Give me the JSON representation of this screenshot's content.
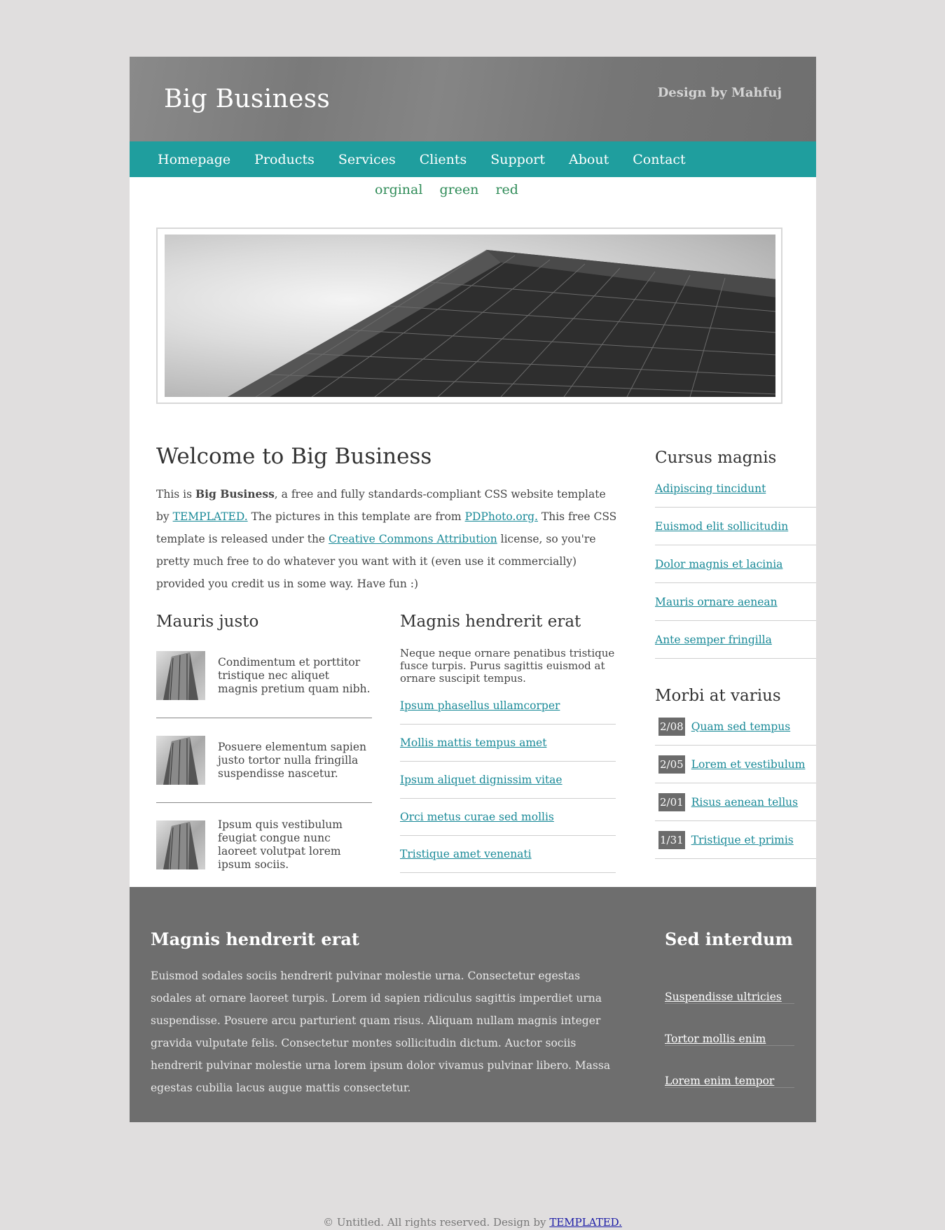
{
  "header": {
    "title": "Big Business",
    "credit": "Design by Mahfuj"
  },
  "nav": [
    "Homepage",
    "Products",
    "Services",
    "Clients",
    "Support",
    "About",
    "Contact"
  ],
  "themes": [
    "orginal",
    "green",
    "red"
  ],
  "welcome": {
    "title": "Welcome to Big Business",
    "p1": "This is ",
    "p_bold": "Big Business",
    "p2": ", a free and fully standards-compliant CSS website template by ",
    "link1": "TEMPLATED.",
    "p3": " The pictures in this template are from ",
    "link2": "PDPhoto.org.",
    "p4": " This free CSS template is released under the ",
    "link3": "Creative Commons Attribution",
    "p5": " license, so you're pretty much free to do whatever you want with it (even use it commercially) provided you credit us in some way. Have fun :)"
  },
  "left_column": {
    "title": "Mauris justo",
    "items": [
      "Condimentum et porttitor tristique nec aliquet magnis pretium quam nibh.",
      "Posuere elementum sapien justo tortor nulla fringilla suspendisse nascetur.",
      "Ipsum quis vestibulum feugiat congue nunc laoreet volutpat lorem ipsum sociis."
    ]
  },
  "mid_column": {
    "title": "Magnis hendrerit erat",
    "text": "Neque neque ornare penatibus tristique fusce turpis. Purus sagittis euismod at ornare suscipit tempus.",
    "links": [
      "Ipsum phasellus ullamcorper",
      "Mollis mattis tempus amet",
      "Ipsum aliquet dignissim vitae",
      "Orci metus curae sed mollis",
      "Tristique amet venenati"
    ]
  },
  "sidebar": {
    "title1": "Cursus magnis",
    "links1": [
      "Adipiscing tincidunt",
      "Euismod elit sollicitudin",
      "Dolor magnis et lacinia",
      "Mauris ornare aenean",
      "Ante semper fringilla"
    ],
    "title2": "Morbi at varius",
    "dated": [
      {
        "date": "2/08",
        "label": "Quam sed tempus"
      },
      {
        "date": "2/05",
        "label": "Lorem et vestibulum"
      },
      {
        "date": "2/01",
        "label": "Risus aenean tellus"
      },
      {
        "date": "1/31",
        "label": "Tristique et primis"
      }
    ]
  },
  "footer": {
    "title": "Magnis hendrerit erat",
    "text": "Euismod sodales sociis hendrerit pulvinar molestie urna. Consectetur egestas sodales at ornare laoreet turpis. Lorem id sapien ridiculus sagittis imperdiet urna suspendisse. Posuere arcu parturient quam risus. Aliquam nullam magnis integer gravida vulputate felis. Consectetur montes sollicitudin dictum. Auctor sociis hendrerit pulvinar molestie urna lorem ipsum dolor vivamus pulvinar libero. Massa egestas cubilia lacus augue mattis consectetur.",
    "side_title": "Sed interdum",
    "side_links": [
      "Suspendisse ultricies",
      "Tortor mollis enim",
      "Lorem enim tempor"
    ]
  },
  "copyright": {
    "text": "© Untitled. All rights reserved. Design by ",
    "link": "TEMPLATED."
  },
  "colors": {
    "nav": "#1f9e9e",
    "link": "#1a8a98",
    "theme_link": "#2e8b57",
    "footer": "#6e6e6e",
    "page_bg": "#e0dede"
  }
}
